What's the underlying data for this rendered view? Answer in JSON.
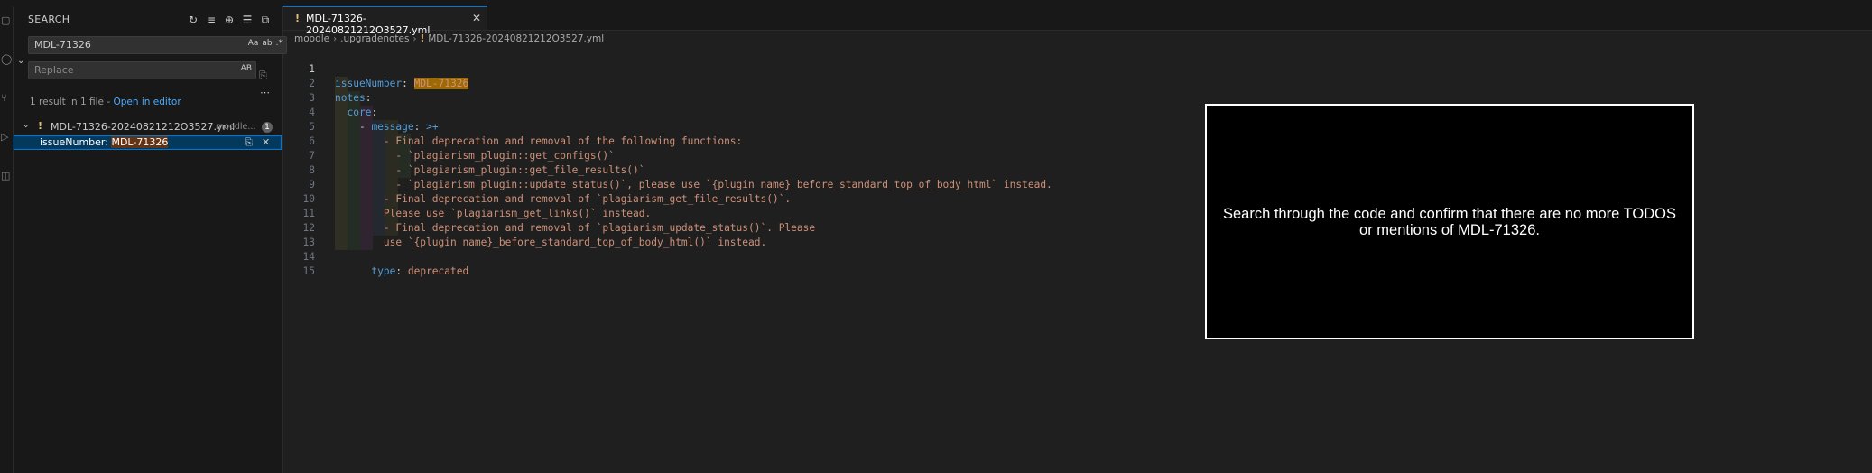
{
  "sidebar": {
    "title": "SEARCH",
    "search_value": "MDL-71326",
    "replace_placeholder": "Replace",
    "replace_option": "AB",
    "summary_text": "1 result in 1 file - ",
    "open_in_editor": "Open in editor",
    "file": {
      "name": "MDL-71326-20240821212O3527.yml",
      "dir": "moodle...",
      "count": "1"
    },
    "match": {
      "prefix": "issueNumber: ",
      "highlight": "MDL-71326"
    }
  },
  "tab": {
    "label": "MDL-71326-20240821212O3527.yml"
  },
  "breadcrumbs": [
    "moodle",
    ".upgradenotes",
    "MDL-71326-20240821212O3527.yml"
  ],
  "code": {
    "l1_key": "issueNumber",
    "l1_val": "MDL-71326",
    "l2_key": "notes",
    "l3_key": "core",
    "l4_dash": "- ",
    "l4_key": "message",
    "l4_val": ">+",
    "l5": "- Final deprecation and removal of the following functions:",
    "l6": "- `plagiarism_plugin::get_configs()`",
    "l7": "- `plagiarism_plugin::get_file_results()`",
    "l8": "- `plagiarism_plugin::update_status()`, please use `{plugin name}_before_standard_top_of_body_html` instead.",
    "l9": "- Final deprecation and removal of `plagiarism_get_file_results()`.",
    "l10": "Please use `plagiarism_get_links()` instead.",
    "l11": "- Final deprecation and removal of `plagiarism_update_status()`. Please",
    "l12": "use `{plugin name}_before_standard_top_of_body_html()` instead.",
    "l14_key": "type",
    "l14_val": "deprecated"
  },
  "line_numbers": [
    "1",
    "2",
    "3",
    "4",
    "5",
    "6",
    "7",
    "8",
    "9",
    "10",
    "11",
    "12",
    "13",
    "14",
    "15"
  ],
  "overlay": {
    "text": "Search through the code and confirm that there are no more TODOS or mentions of MDL-71326."
  }
}
